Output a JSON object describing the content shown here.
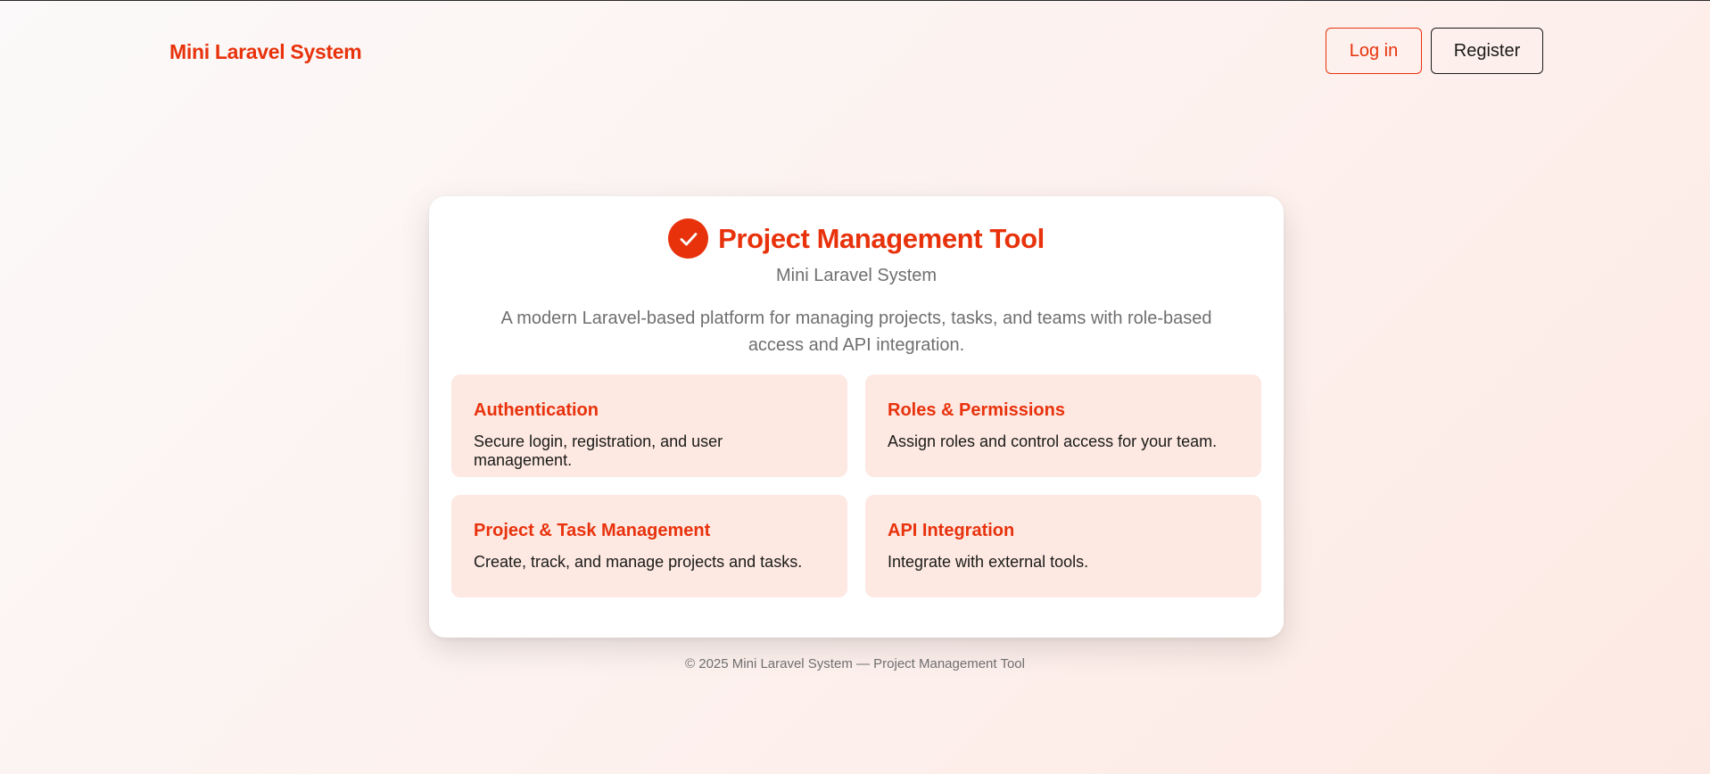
{
  "header": {
    "brand": "Mini Laravel System",
    "login_label": "Log in",
    "register_label": "Register"
  },
  "hero": {
    "icon": "check-circle-icon",
    "title": "Project Management Tool",
    "subtitle": "Mini Laravel System",
    "description": "A modern Laravel-based platform for managing projects, tasks, and teams with role-based access and API integration."
  },
  "features": [
    {
      "title": "Authentication",
      "description": "Secure login, registration, and user management."
    },
    {
      "title": "Roles & Permissions",
      "description": "Assign roles and control access for your team."
    },
    {
      "title": "Project & Task Management",
      "description": "Create, track, and manage projects and tasks."
    },
    {
      "title": "API Integration",
      "description": "Integrate with external tools."
    }
  ],
  "footer": {
    "text": "© 2025 Mini Laravel System — Project Management Tool"
  },
  "colors": {
    "accent": "#e8320c",
    "feature_bg": "#fde8e2",
    "text_dark": "#1b1b18",
    "text_muted": "#6f6f6f"
  }
}
